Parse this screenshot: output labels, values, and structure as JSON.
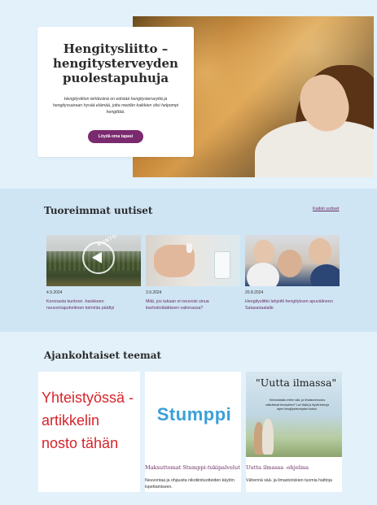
{
  "hero": {
    "title": "Hengitysliitto – hengitysterveyden puolestapuhuja",
    "text": "Hengitysliiton tehtävänä on edistää hengitysterveyttä ja hengityssairaan hyvää elämää, jotta meidän kaikkien olisi helpompi hengittää.",
    "button_label": "Löydä oma tapasi osallistua!"
  },
  "news": {
    "heading": "Tuoreimmat uutiset",
    "all_link": "Kaikki uutiset",
    "items": [
      {
        "date": "4.9.2024",
        "title": "Koronasta kuntoon -hankkeen neuvontapuhelimen toiminta päättyi",
        "image_text": "KUNTO"
      },
      {
        "date": "3.9.2024",
        "title": "Mitä, jos tukaan ei neuvoisi sinua itsehoitolääkkeen valinnassa?"
      },
      {
        "date": "20.8.2024",
        "title": "Hengitysliitto lahjoitti hengityksen apuvälineen Satasairaalalle"
      }
    ]
  },
  "themes": {
    "heading": "Ajankohtaiset teemat",
    "promo_text": "Yhteistyössä -artikkelin nosto tähän",
    "cards": [
      {
        "logo_text": "Stumppi",
        "title": "Maksuttomat Stumppi-tukipalvelut",
        "text": "Neuvontaa ja ohjausta nikotiinituotteiden käytön lopettamiseen."
      },
      {
        "image_title": "\"Uutta ilmassa\"",
        "image_subtitle": "Kiinnostaako miten sää- ja ilmastonmuutos vaikuttavat terveyteen? Lue lisää ja löydä keinoja arjen hengitysterveyden tueksi.",
        "title": "Uutta ilmassa -ohjelma",
        "text": "Vähennä sää- ja ilmastoriskien tuomia haittoja"
      }
    ]
  },
  "colors": {
    "accent": "#7a2a6e",
    "link": "#6b2b63",
    "promo_red": "#d6242a",
    "hero_bg": "#e3f1fa",
    "news_bg": "#cfe5f4",
    "stumppi_blue": "#3aa0d8"
  }
}
